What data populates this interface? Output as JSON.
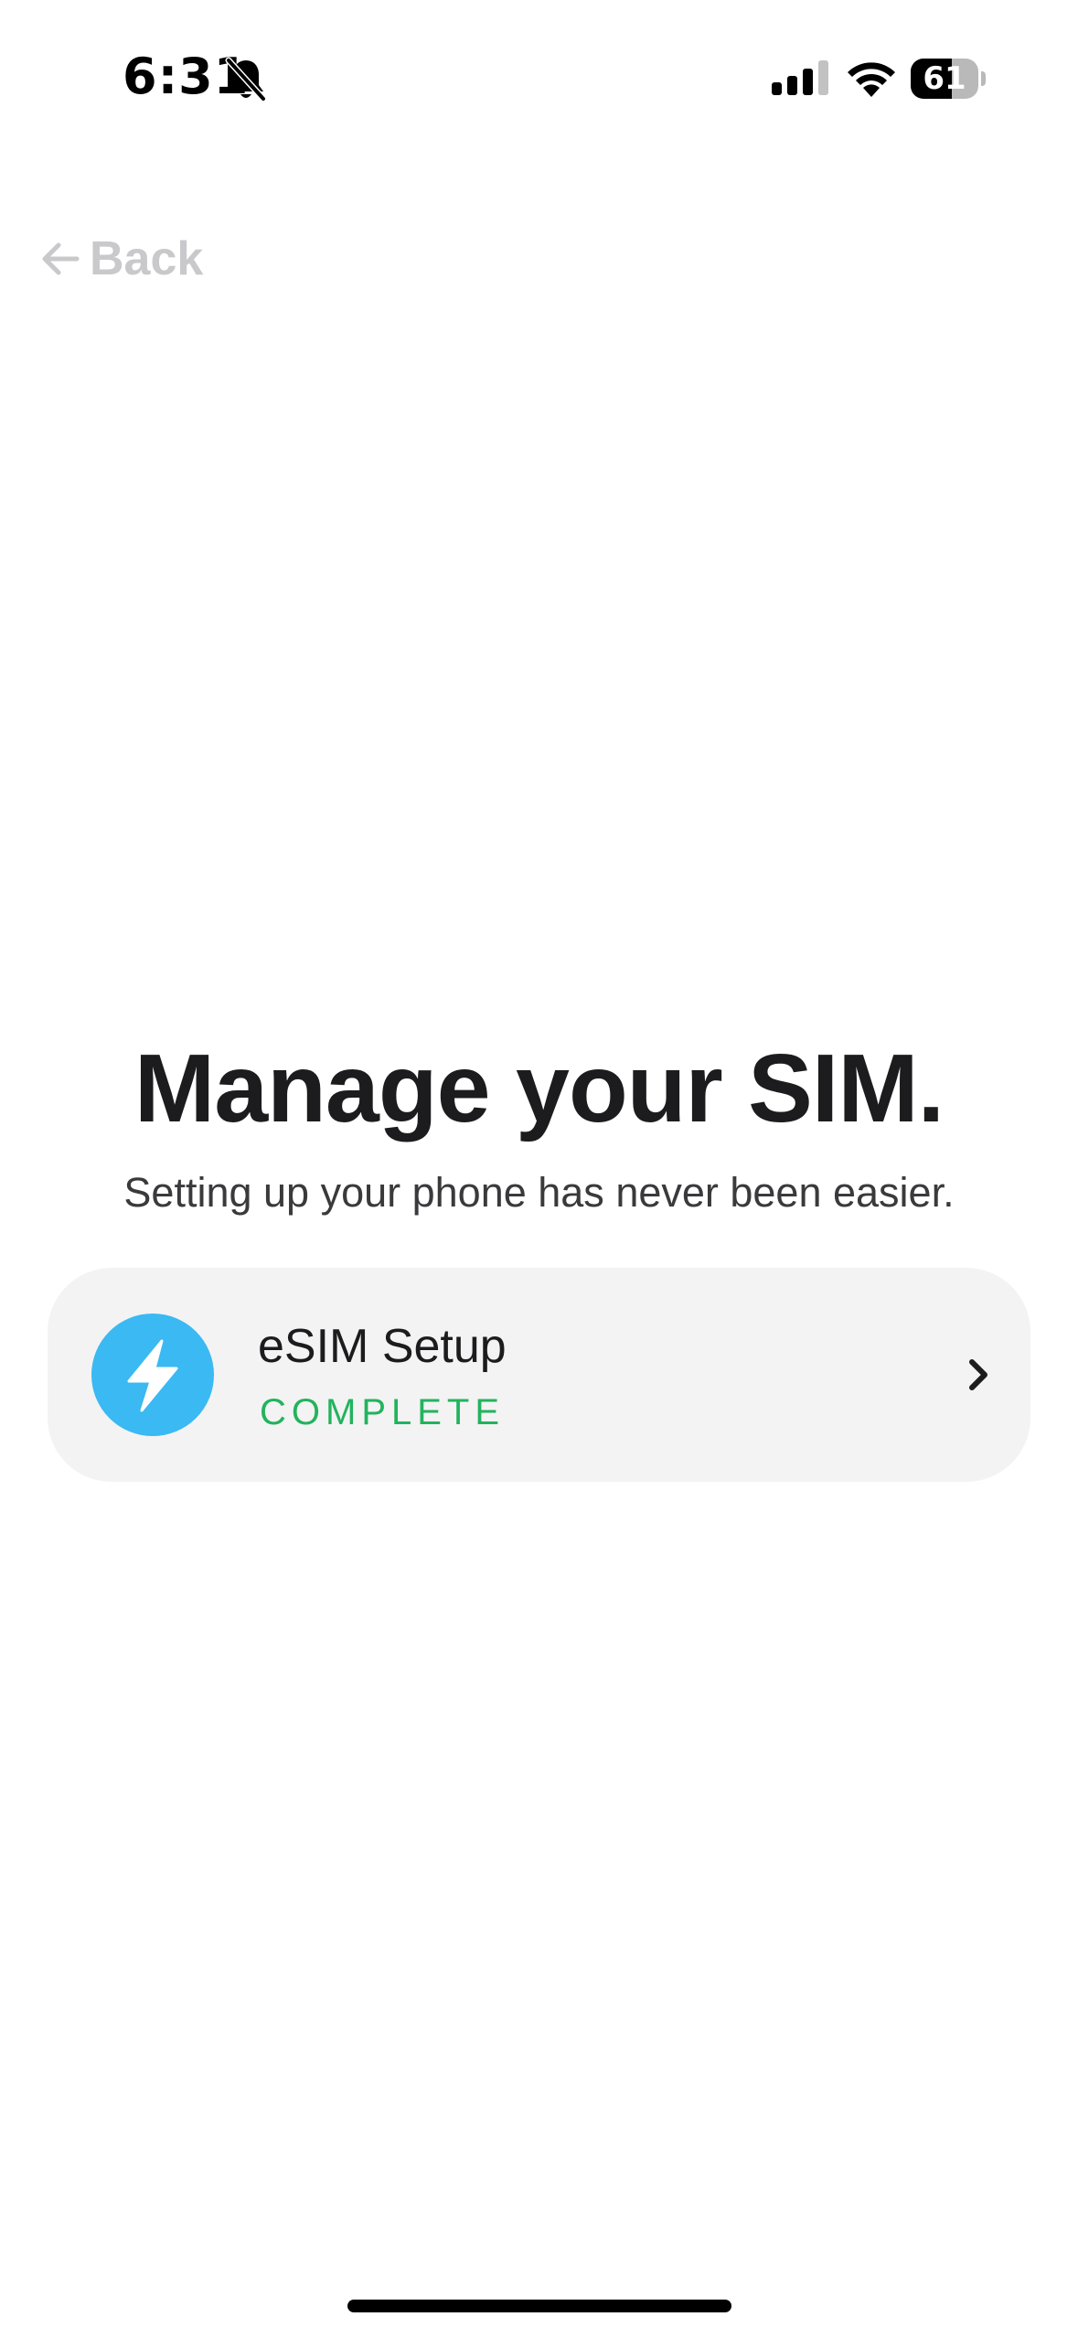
{
  "status_bar": {
    "time": "6:31",
    "battery_level": "61",
    "battery_fraction": 0.61
  },
  "nav": {
    "back_label": "Back"
  },
  "heading": {
    "title": "Manage your SIM.",
    "subtitle": "Setting up your phone has never been easier."
  },
  "card": {
    "title": "eSIM Setup",
    "status": "COMPLETE",
    "icon": "lightning-icon",
    "icon_bg": "#3ab9f2",
    "status_color": "#22b35e"
  }
}
